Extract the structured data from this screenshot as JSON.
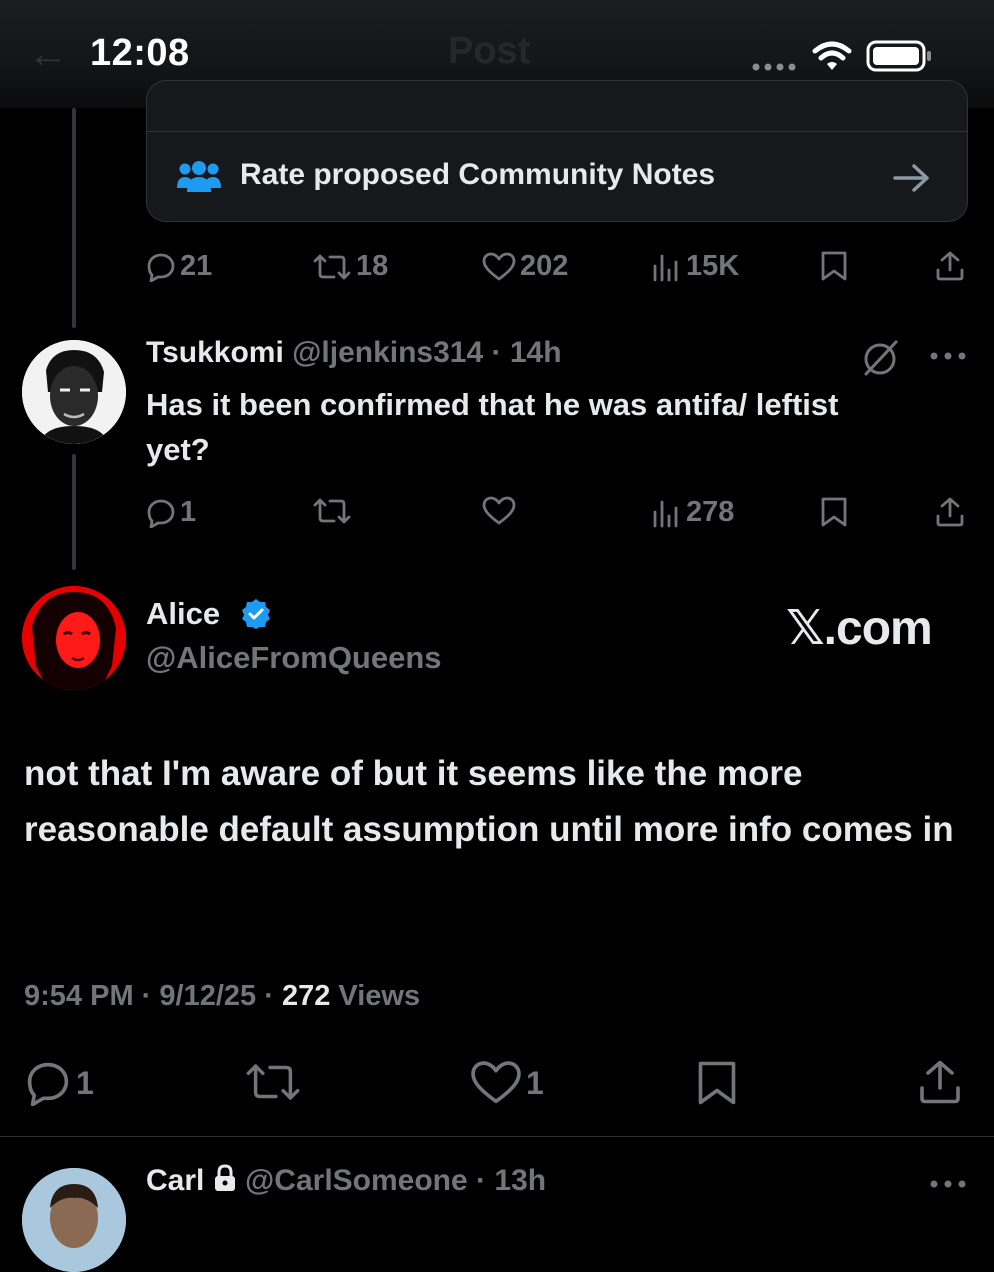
{
  "status_bar": {
    "time": "12:08",
    "ghost_title": "Post",
    "icons": [
      "signal-dots-icon",
      "wifi-icon",
      "battery-icon"
    ]
  },
  "community_notes": {
    "label": "Rate proposed Community Notes",
    "icon": "people-icon",
    "arrow": "arrow-right-icon"
  },
  "parent_post_actions": {
    "replies": "21",
    "reposts": "18",
    "likes": "202",
    "views": "15K"
  },
  "reply_post": {
    "display_name": "Tsukkomi",
    "handle": "@ljenkins314",
    "time": "14h",
    "separator": "·",
    "text": "Has it been confirmed that he was antifa/ leftist yet?",
    "actions": {
      "replies": "1",
      "reposts": "",
      "likes": "",
      "views": "278"
    }
  },
  "main_post": {
    "display_name": "Alice",
    "handle": "@AliceFromQueens",
    "verified": true,
    "watermark": "𝕏.com",
    "text": "not that I'm aware of but it seems like the more reasonable default assumption until more info comes in",
    "time": "9:54 PM",
    "date": "9/12/25",
    "views_count": "272",
    "views_label": "Views",
    "separator": "·",
    "actions": {
      "replies": "1",
      "reposts": "",
      "likes": "1"
    }
  },
  "next_post": {
    "display_name": "Carl",
    "handle": "@CarlSomeone",
    "time": "13h",
    "separator": "·",
    "locked": true
  },
  "colors": {
    "background": "#000000",
    "text": "#e7e9ea",
    "muted": "#71767b",
    "accent": "#1d9bf0",
    "border": "#2f3336"
  }
}
